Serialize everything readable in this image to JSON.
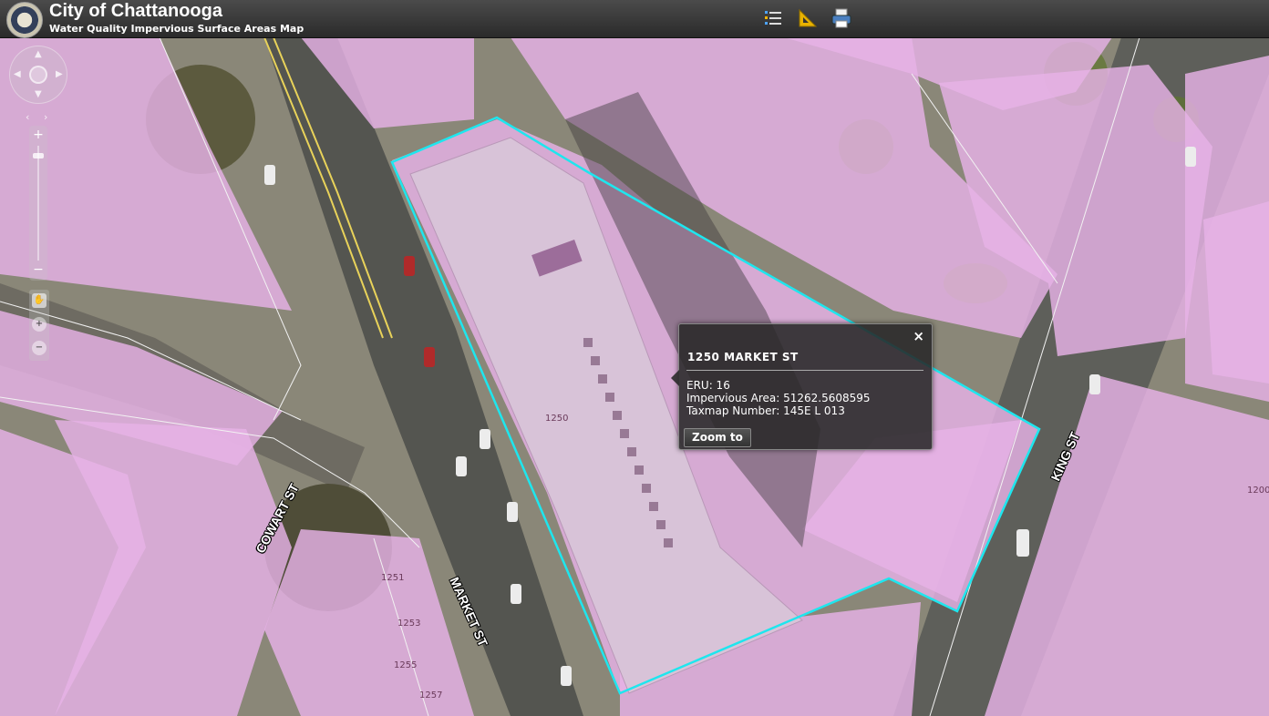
{
  "header": {
    "title": "City of Chattanooga",
    "subtitle": "Water Quality Impervious Surface Areas Map",
    "tools": [
      "legend-icon",
      "measure-icon",
      "print-icon"
    ]
  },
  "popup": {
    "title": "1250 MARKET  ST",
    "close": "×",
    "lines": [
      "ERU: 16",
      "Impervious Area: 51262.5608595",
      "Taxmap Number: 145E L 013"
    ],
    "zoom_button": "Zoom to"
  },
  "map": {
    "streets": {
      "cowart": "COWART ST",
      "market": "MARKET ST",
      "king": "KING ST"
    },
    "parcels": [
      "1250",
      "1251",
      "1253",
      "1255",
      "1257",
      "1200"
    ]
  },
  "colors": {
    "impervious_fill": "#e7b2e6",
    "selection_outline": "#1ee6ee",
    "header_bg": "#333333"
  }
}
